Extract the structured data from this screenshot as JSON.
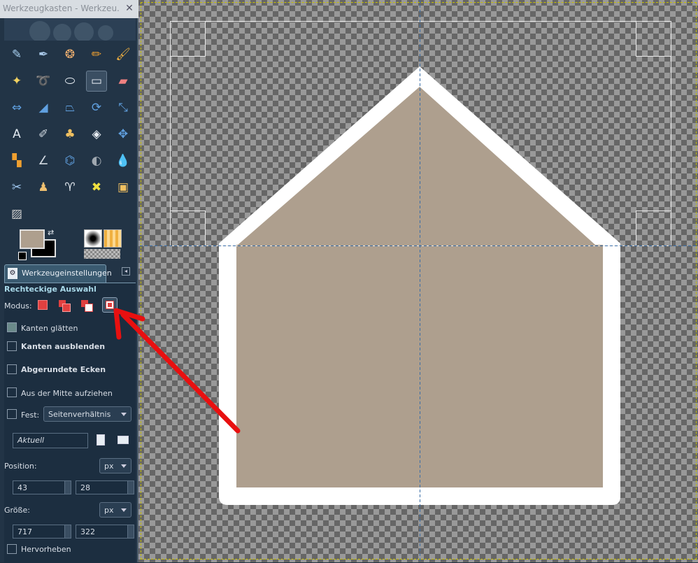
{
  "window": {
    "title": "Werkzeugkasten - Werkzeu..."
  },
  "toolbox": {
    "tools": [
      {
        "name": "airbrush-icon",
        "glyph": "✎",
        "color": "#a8d0f0"
      },
      {
        "name": "ink-icon",
        "glyph": "✒",
        "color": "#a8c8e8"
      },
      {
        "name": "clone-icon",
        "glyph": "❂",
        "color": "#f0b070"
      },
      {
        "name": "pencil-icon",
        "glyph": "✏",
        "color": "#f0a030"
      },
      {
        "name": "paintbrush-icon",
        "glyph": "🖌",
        "color": "#f0b040"
      },
      {
        "name": "fuzzy-select-icon",
        "glyph": "✦",
        "color": "#f0d060"
      },
      {
        "name": "free-select-icon",
        "glyph": "➰",
        "color": "#d0d8e0"
      },
      {
        "name": "ellipse-select-icon",
        "glyph": "⬭",
        "color": "#e8eef4"
      },
      {
        "name": "rect-select-icon",
        "glyph": "▭",
        "color": "#e8eef4"
      },
      {
        "name": "eraser-icon",
        "glyph": "▰",
        "color": "#f08080"
      },
      {
        "name": "flip-icon",
        "glyph": "⇔",
        "color": "#60a0e0"
      },
      {
        "name": "perspective-icon",
        "glyph": "◢",
        "color": "#60a0e0"
      },
      {
        "name": "shear-icon",
        "glyph": "⏢",
        "color": "#60a0e0"
      },
      {
        "name": "rotate-icon",
        "glyph": "⟳",
        "color": "#60a0e0"
      },
      {
        "name": "scale-icon",
        "glyph": "⤡",
        "color": "#60a0e0"
      },
      {
        "name": "text-icon",
        "glyph": "A",
        "color": "#e0e8f0"
      },
      {
        "name": "smudge-icon",
        "glyph": "✐",
        "color": "#d0d8e0"
      },
      {
        "name": "heal-icon",
        "glyph": "♣",
        "color": "#f0c060"
      },
      {
        "name": "bucket-fill-icon",
        "glyph": "◈",
        "color": "#e8eef4"
      },
      {
        "name": "move-icon",
        "glyph": "✥",
        "color": "#60a0e0"
      },
      {
        "name": "align-icon",
        "glyph": "▚",
        "color": "#f0a030"
      },
      {
        "name": "measure-icon",
        "glyph": "∠",
        "color": "#d0d8e0"
      },
      {
        "name": "path-icon",
        "glyph": "⌬",
        "color": "#60a0e0"
      },
      {
        "name": "color-picker-icon",
        "glyph": "◐",
        "color": "#a0a8b0"
      },
      {
        "name": "blur-icon",
        "glyph": "💧",
        "color": "#60a0e0"
      },
      {
        "name": "scissors-icon",
        "glyph": "✂",
        "color": "#a0c8f0"
      },
      {
        "name": "foreground-select-icon",
        "glyph": "♟",
        "color": "#f0c070"
      },
      {
        "name": "dodge-burn-icon",
        "glyph": "♈",
        "color": "#e8eef4"
      },
      {
        "name": "cage-transform-icon",
        "glyph": "✖",
        "color": "#f0e040"
      },
      {
        "name": "color-select-icon",
        "glyph": "▣",
        "color": "#f0c060"
      },
      {
        "name": "blend-icon",
        "glyph": "▨",
        "color": "#d0d0d0"
      }
    ],
    "fg_color": "#ae9f8e",
    "bg_color": "#000000"
  },
  "options": {
    "tab_label": "Werkzeugeinstellungen",
    "heading": "Rechteckige Auswahl",
    "mode_label": "Modus:",
    "antialias_label": "Kanten glätten",
    "feather_label": "Kanten ausblenden",
    "rounded_label": "Abgerundete Ecken",
    "center_label": "Aus der Mitte aufziehen",
    "fixed_label": "Fest:",
    "fixed_value": "Seitenverhältnis",
    "current_value": "Aktuell",
    "position_label": "Position:",
    "position_unit": "px",
    "pos_x": "43",
    "pos_y": "28",
    "size_label": "Größe:",
    "size_unit": "px",
    "size_w": "717",
    "size_h": "322",
    "highlight_label": "Hervorheben"
  },
  "canvas": {
    "shape_color": "#ae9f8e",
    "outline_color": "#ffffff",
    "guide_color": "#3a6ea8",
    "arrow_color": "#e81010"
  }
}
